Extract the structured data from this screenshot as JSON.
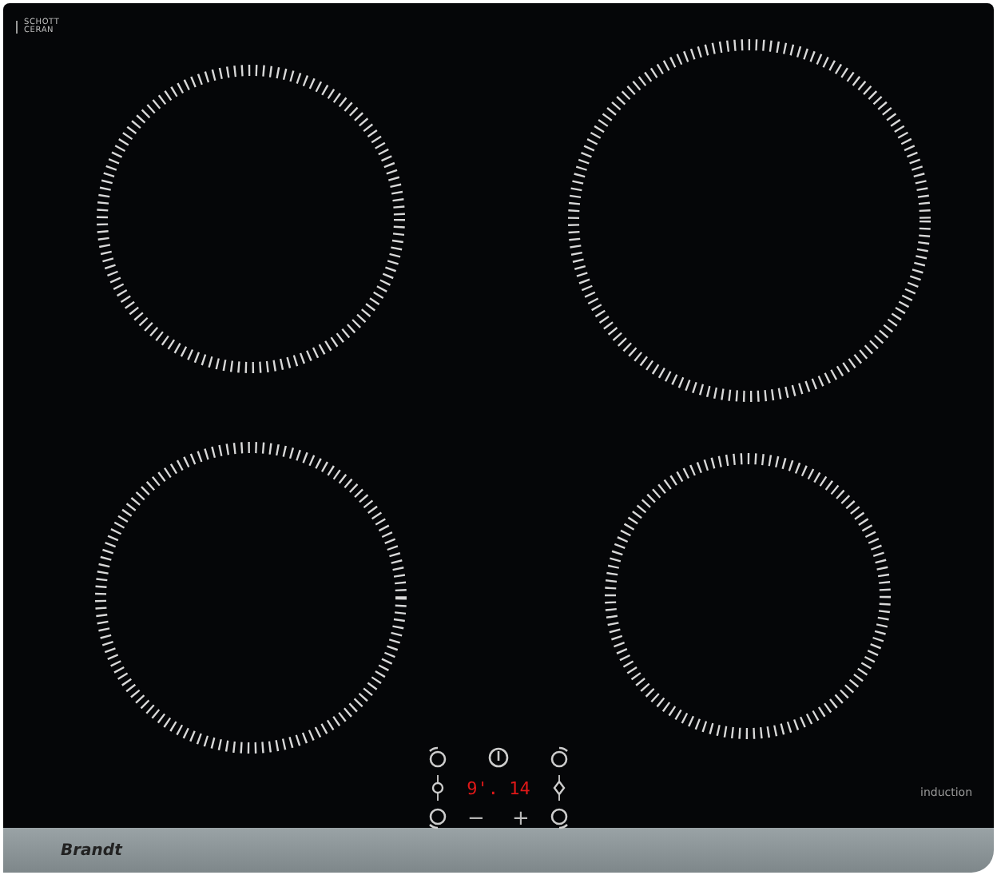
{
  "glass_mark": {
    "line_1": "SCHOTT",
    "line_2": "CERAN"
  },
  "controls": {
    "display": "9'. 14",
    "minus": "−",
    "plus": "+"
  },
  "type_label": "induction",
  "brand": "Brandt"
}
